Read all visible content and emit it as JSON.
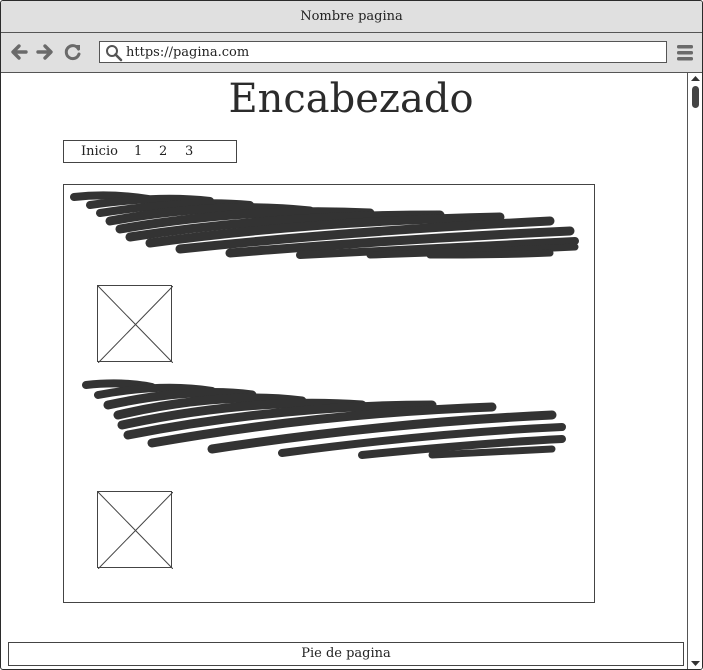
{
  "window": {
    "title": "Nombre pagina"
  },
  "browser": {
    "url": "https://pagina.com",
    "icons": [
      "back-arrow-icon",
      "forward-arrow-icon",
      "reload-icon",
      "search-icon",
      "hamburger-menu-icon"
    ]
  },
  "page": {
    "heading": "Encabezado",
    "breadcrumb": {
      "items": [
        "Inicio",
        "1",
        "2",
        "3"
      ]
    },
    "footer": "Pie de pagina"
  },
  "colors": {
    "chrome": "#e0e0e0",
    "scribble": "#333333",
    "border": "#444444"
  }
}
